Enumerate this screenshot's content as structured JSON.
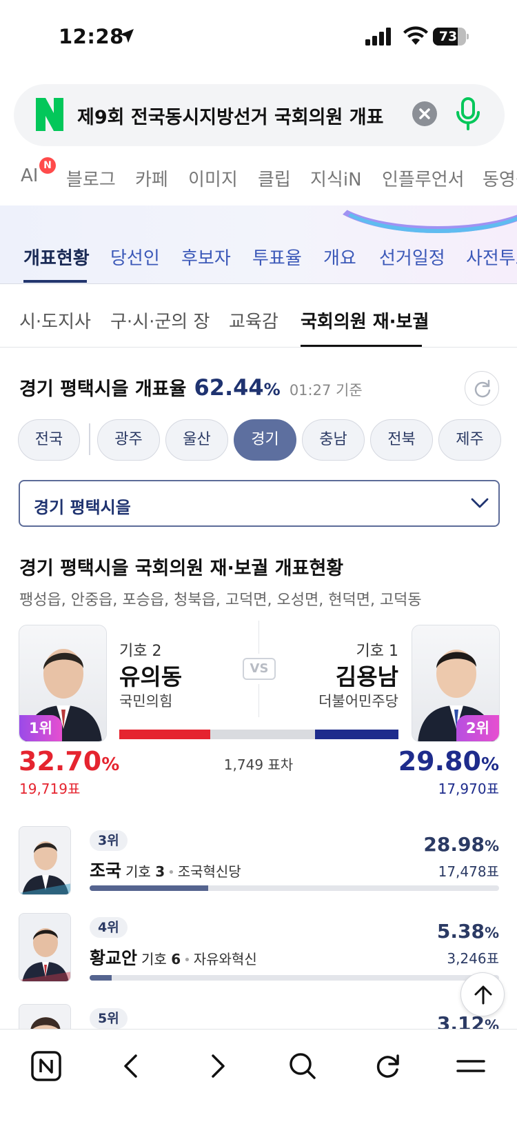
{
  "status_bar": {
    "time": "12:28",
    "battery": "73"
  },
  "search": {
    "query": "제9회 전국동시지방선거 국회의원 개표"
  },
  "service_tabs": [
    "AI",
    "블로그",
    "카페",
    "이미지",
    "클립",
    "지식iN",
    "인플루언서",
    "동영상"
  ],
  "ai_badge": "N",
  "election_tabs": [
    "개표현황",
    "당선인",
    "후보자",
    "투표율",
    "개요",
    "선거일정",
    "사전투표"
  ],
  "sub_tabs": [
    "시·도지사",
    "구·시·군의 장",
    "교육감",
    "국회의원 재·보궐"
  ],
  "rate": {
    "label": "경기 평택시을 개표율",
    "value": "62.44",
    "unit": "%",
    "base": "01:27 기준"
  },
  "regions": [
    "전국",
    "광주",
    "울산",
    "경기",
    "충남",
    "전북",
    "제주"
  ],
  "selected_region": "경기",
  "district_select": "경기 평택시을",
  "section": {
    "title": "경기 평택시을 국회의원 재·보궐 개표현황",
    "towns": "팽성읍, 안중읍, 포승읍, 청북읍, 고덕면, 오성면, 현덕면, 고덕동"
  },
  "faceoff": {
    "left": {
      "rank": "1위",
      "number": "기호 2",
      "name": "유의동",
      "party": "국민의힘",
      "pct": "32.70",
      "votes": "19,719표",
      "color": "#e5242f"
    },
    "right": {
      "rank": "2위",
      "number": "기호 1",
      "name": "김용남",
      "party": "더불어민주당",
      "pct": "29.80",
      "votes": "17,970표",
      "color": "#1e2c8c"
    },
    "vs": "VS",
    "gap": "1,749 표차",
    "pct_unit": "%"
  },
  "others": [
    {
      "rank": "3위",
      "name": "조국",
      "number_prefix": "기호",
      "number": "3",
      "party": "조국혁신당",
      "pct": "28.98",
      "votes": "17,478표",
      "share": 0.2898
    },
    {
      "rank": "4위",
      "name": "황교안",
      "number_prefix": "기호",
      "number": "6",
      "party": "자유와혁신",
      "pct": "5.38",
      "votes": "3,246표",
      "share": 0.0538
    },
    {
      "rank": "5위",
      "pct": "3.12"
    }
  ],
  "colors": {
    "accent": "#1f3370",
    "chip_active": "#5d6f9f",
    "red": "#e5242f",
    "blue": "#1e2c8c",
    "naver_green": "#03c75a"
  },
  "bottom_nav": [
    "naver-home-icon",
    "back-icon",
    "forward-icon",
    "search-icon",
    "reload-icon",
    "menu-icon"
  ]
}
